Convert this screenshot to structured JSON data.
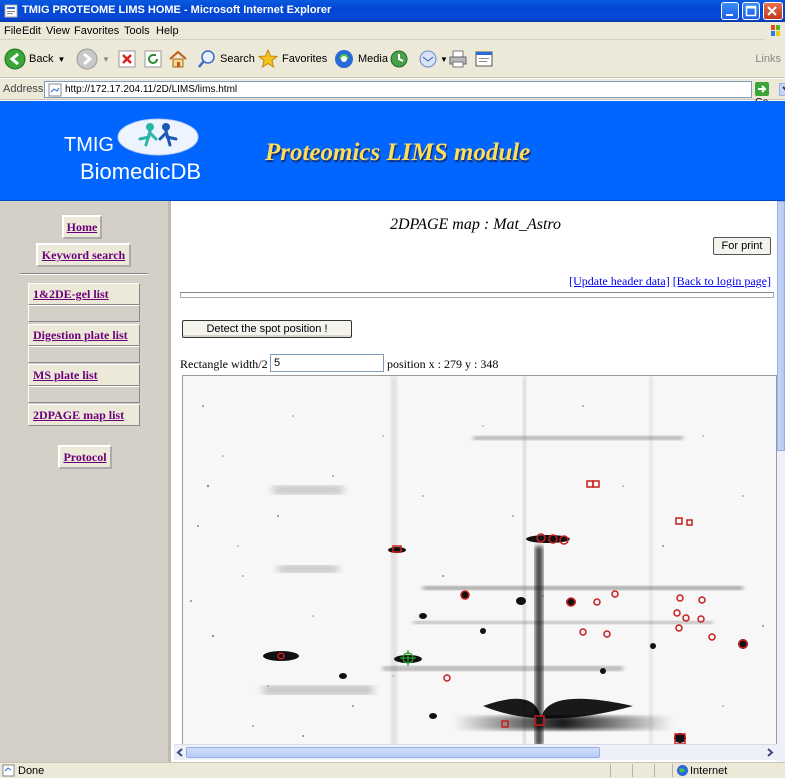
{
  "window": {
    "title": "TMIG PROTEOME LIMS HOME - Microsoft Internet Explorer"
  },
  "menu": [
    "File",
    "Edit",
    "View",
    "Favorites",
    "Tools",
    "Help"
  ],
  "toolbar": {
    "back_label": "Back",
    "search_label": "Search",
    "favorites_label": "Favorites",
    "media_label": "Media",
    "links_label": "Links"
  },
  "address": {
    "label": "Address",
    "url": "http://172.17.204.11/2D/LIMS/lims.html",
    "go_label": "Go"
  },
  "header": {
    "logo_line1": "TMIG",
    "logo_line2": "BiomedicDB",
    "module_title": "Proteomics LIMS module"
  },
  "sidebar": {
    "home": "Home",
    "keyword_search": "Keyword search",
    "items": [
      "1&2DE-gel list",
      "Digestion plate list",
      "MS plate list",
      "2DPAGE map list"
    ],
    "protocol": "Protocol"
  },
  "main": {
    "map_title": "2DPAGE map : Mat_Astro",
    "print_button": "For print",
    "update_link": "[Update header data]",
    "back_link": "[Back to login page]",
    "detect_button": "Detect the spot position !",
    "rect_label": "Rectangle width/2",
    "rect_value": "5",
    "position_label": "position x : 279 y : 348"
  },
  "status": {
    "left": "Done",
    "zone": "Internet"
  },
  "colors": {
    "header_bg": "#0066ff",
    "module_title": "#ffdf5a",
    "nav_link": "#6b007b",
    "spot_marker": "#c81e1e"
  }
}
